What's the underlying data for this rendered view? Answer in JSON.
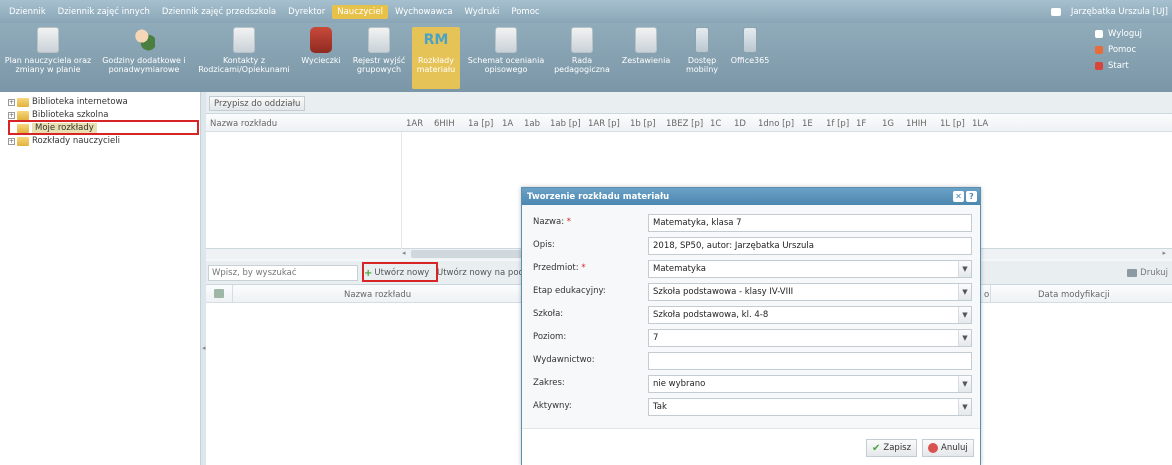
{
  "topmenu": {
    "items": [
      "Dziennik",
      "Dziennik zajęć innych",
      "Dziennik zajęć przedszkola",
      "Dyrektor",
      "Nauczyciel",
      "Wychowawca",
      "Wydruki",
      "Pomoc"
    ],
    "active": "Nauczyciel",
    "user": "Jarzębatka Urszula [UJ]"
  },
  "ribbon": {
    "buttons": [
      {
        "label": "Plan nauczyciela oraz\nzmiany w planie",
        "icon": "schedule-icon"
      },
      {
        "label": "Godziny dodatkowe i\nponadwymiarowe",
        "icon": "people-icon"
      },
      {
        "label": "Kontakty z\nRodzicami/Opiekunami",
        "icon": "contacts-icon"
      },
      {
        "label": "Wycieczki",
        "icon": "bag-icon"
      },
      {
        "label": "Rejestr wyjść\ngrupowych",
        "icon": "register-icon"
      },
      {
        "label": "Rozkłady\nmateriału",
        "icon": "rm-icon"
      },
      {
        "label": "Schemat oceniania\nopisowego",
        "icon": "grading-icon"
      },
      {
        "label": "Rada\npedagogiczna",
        "icon": "council-icon"
      },
      {
        "label": "Zestawienia",
        "icon": "report-icon"
      },
      {
        "label": "Dostęp\nmobilny",
        "icon": "mobile-icon"
      },
      {
        "label": "Office365",
        "icon": "office-icon"
      }
    ],
    "rm_text": "RM",
    "links": [
      "Wyloguj",
      "Pomoc",
      "Start"
    ]
  },
  "tree": {
    "items": [
      "Biblioteka internetowa",
      "Biblioteka szkolna",
      "Moje rozkłady",
      "Rozkłady nauczycieli"
    ],
    "selected": "Moje rozkłady"
  },
  "upper": {
    "assign_button": "Przypisz do oddziału",
    "name_header": "Nazwa rozkładu",
    "class_headers": [
      "1AR",
      "6HIH",
      "1a [p]",
      "1A",
      "1ab",
      "1ab [p]",
      "1AR [p]",
      "1b [p]",
      "1BEZ [p]",
      "1C",
      "1D",
      "1dno [p]",
      "1E",
      "1f [p]",
      "1F",
      "1G",
      "1HIH",
      "1L [p]",
      "1LA"
    ]
  },
  "lower": {
    "search_placeholder": "Wpisz, by wyszukać",
    "new_button": "Utwórz nowy",
    "new_from_button": "Utwórz nowy na pod",
    "print_button": "Drukuj",
    "col_name": "Nazwa rozkładu",
    "col_tail": "o",
    "col_modified": "Data modyfikacji"
  },
  "dialog": {
    "title": "Tworzenie rozkładu materiału",
    "fields": [
      {
        "label": "Nazwa:",
        "required": true,
        "value": "Matematyka, klasa 7",
        "type": "text"
      },
      {
        "label": "Opis:",
        "required": false,
        "value": "2018, SP50, autor: Jarzębatka Urszula",
        "type": "text"
      },
      {
        "label": "Przedmiot:",
        "required": true,
        "value": "Matematyka",
        "type": "select"
      },
      {
        "label": "Etap edukacyjny:",
        "required": false,
        "value": "Szkoła podstawowa - klasy IV-VIII",
        "type": "select"
      },
      {
        "label": "Szkoła:",
        "required": false,
        "value": "Szkoła podstawowa, kl. 4-8",
        "type": "select"
      },
      {
        "label": "Poziom:",
        "required": false,
        "value": "7",
        "type": "select"
      },
      {
        "label": "Wydawnictwo:",
        "required": false,
        "value": "",
        "type": "text"
      },
      {
        "label": "Zakres:",
        "required": false,
        "value": "nie wybrano",
        "type": "select"
      },
      {
        "label": "Aktywny:",
        "required": false,
        "value": "Tak",
        "type": "select"
      }
    ],
    "save": "Zapisz",
    "cancel": "Anuluj"
  },
  "colors": {
    "accent_active": "#e6c357",
    "ribbon": "#7b97a7",
    "highlight_red": "#d72424",
    "dialog_header": "#4c87b0"
  }
}
